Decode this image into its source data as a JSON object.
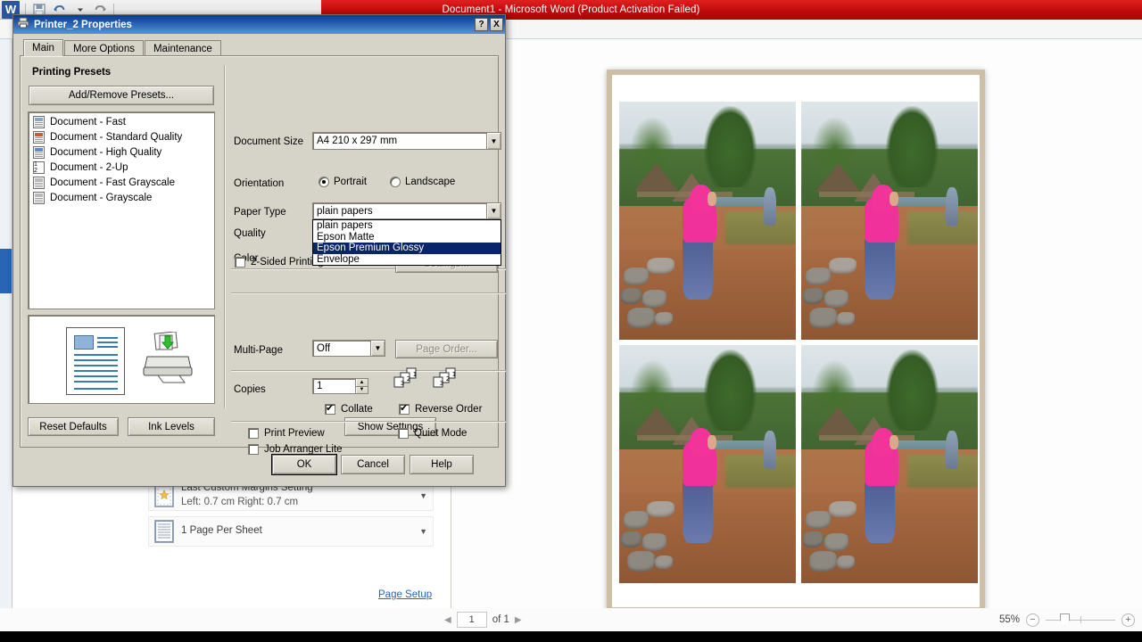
{
  "word": {
    "title": "Document1 - Microsoft Word (Product Activation Failed)",
    "logo": "W",
    "qat_icons": [
      "save-icon",
      "undo-icon",
      "redo-icon"
    ],
    "settings_rows": [
      {
        "title": "Last Custom Margins Setting",
        "sub": "Left: 0.7 cm   Right: 0.7 cm",
        "icon": "margins-icon"
      },
      {
        "title": "1 Page Per Sheet",
        "sub": "",
        "icon": "pages-per-sheet-icon"
      }
    ],
    "page_setup_link": "Page Setup",
    "status": {
      "page_current": "1",
      "page_of": "of 1",
      "zoom_level": "55%",
      "zoom_out": "−",
      "zoom_in": "+"
    },
    "preview_photo_alt": "photo of person in pink hijab on rural path"
  },
  "dialog": {
    "title": "Printer_2 Properties",
    "titlebar_icon": "printer-icon",
    "help_button": "?",
    "close_button": "X",
    "tabs": [
      {
        "label": "Main",
        "active": true
      },
      {
        "label": "More Options",
        "active": false
      },
      {
        "label": "Maintenance",
        "active": false
      }
    ],
    "presets": {
      "section_title": "Printing Presets",
      "add_remove_label": "Add/Remove Presets...",
      "items": [
        {
          "label": "Document - Fast",
          "icon": "doc-fast-icon"
        },
        {
          "label": "Document - Standard Quality",
          "icon": "doc-standard-icon"
        },
        {
          "label": "Document - High Quality",
          "icon": "doc-high-icon"
        },
        {
          "label": "Document - 2-Up",
          "icon": "doc-2up-icon"
        },
        {
          "label": "Document - Fast Grayscale",
          "icon": "doc-fast-gray-icon"
        },
        {
          "label": "Document - Grayscale",
          "icon": "doc-gray-icon"
        }
      ]
    },
    "fields": {
      "document_size_label": "Document Size",
      "document_size_value": "A4 210 x 297 mm",
      "orientation_label": "Orientation",
      "orientation_portrait": "Portrait",
      "orientation_landscape": "Landscape",
      "orientation_selected": "Portrait",
      "paper_type_label": "Paper Type",
      "paper_type_value": "plain papers",
      "paper_type_options": [
        "plain papers",
        "Epson Matte",
        "Epson Premium Glossy",
        "Envelope"
      ],
      "paper_type_highlighted": "Epson Premium Glossy",
      "quality_label": "Quality",
      "color_label": "Color",
      "two_sided_label": "2-Sided Printing",
      "two_sided_checked": false,
      "settings_button": "Settings...",
      "multi_page_label": "Multi-Page",
      "multi_page_value": "Off",
      "page_order_button": "Page Order...",
      "copies_label": "Copies",
      "copies_value": "1",
      "collate_label": "Collate",
      "collate_checked": true,
      "reverse_order_label": "Reverse Order",
      "reverse_order_checked": true,
      "print_preview_label": "Print Preview",
      "print_preview_checked": false,
      "quiet_mode_label": "Quiet Mode",
      "quiet_mode_checked": false,
      "job_arranger_label": "Job Arranger Lite",
      "job_arranger_checked": false
    },
    "buttons": {
      "reset_defaults": "Reset Defaults",
      "ink_levels": "Ink Levels",
      "show_settings": "Show Settings",
      "ok": "OK",
      "cancel": "Cancel",
      "help": "Help"
    }
  },
  "colors": {
    "word_accent": "#c00a0a",
    "dialog_title": "#2a64b5",
    "dropdown_highlight": "#0a246a",
    "dialog_face": "#d6d3c8"
  }
}
